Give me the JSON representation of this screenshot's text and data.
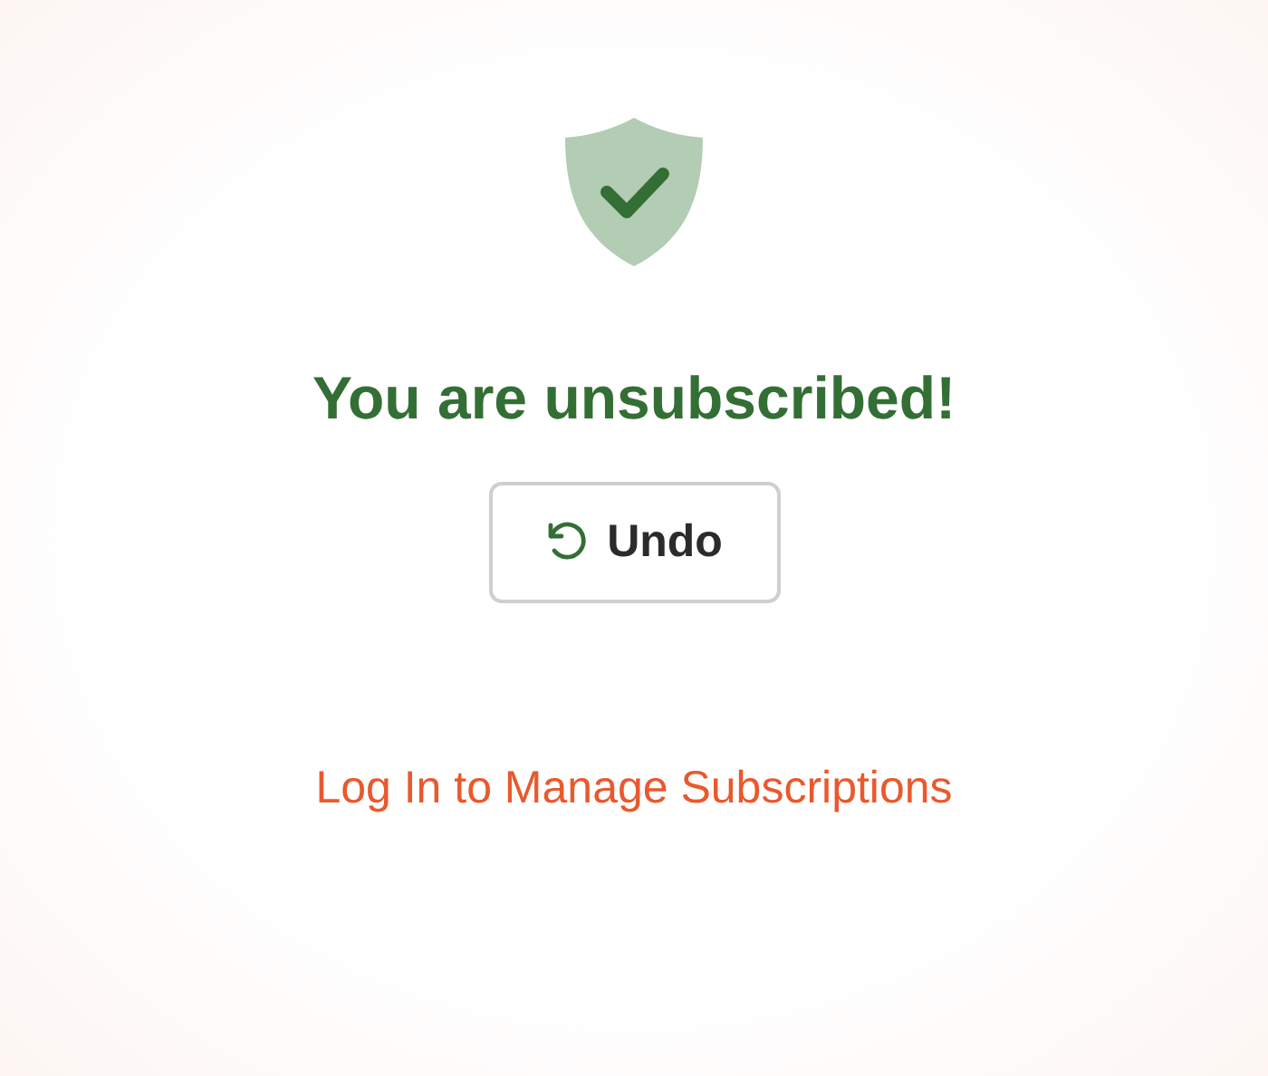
{
  "title": "You are unsubscribed!",
  "undo_button": {
    "label": "Undo"
  },
  "link": "Log In to Manage Subscriptions"
}
